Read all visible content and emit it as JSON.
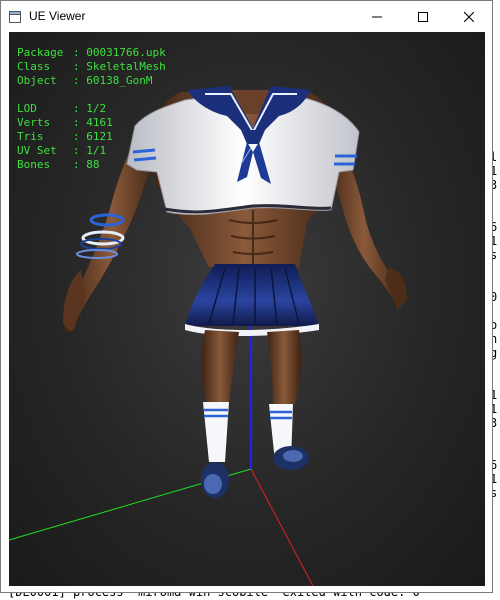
{
  "window": {
    "title": "UE Viewer",
    "app_icon": "window-app-icon"
  },
  "controls": {
    "minimize": "minimize-icon",
    "maximize": "maximize-icon",
    "close": "close-icon"
  },
  "info": {
    "package_label": "Package",
    "package_value": "00031766.upk",
    "class_label": "Class",
    "class_value": "SkeletalMesh",
    "object_label": "Object",
    "object_value": "60138_GonM",
    "lod_label": "LOD",
    "lod_value": "1/2",
    "verts_label": "Verts",
    "verts_value": "4161",
    "tris_label": "Tris",
    "tris_value": "6121",
    "uvset_label": "UV Set",
    "uvset_value": "1/1",
    "bones_label": "Bones",
    "bones_value": "88"
  },
  "console": {
    "side_lines": [
      "l",
      "1",
      "3",
      "",
      "",
      "6",
      "1",
      "s",
      "",
      "",
      "0",
      "",
      "o",
      "n",
      "g",
      "",
      "",
      "1",
      "1",
      "3",
      "",
      "",
      "6",
      "1",
      "s"
    ],
    "bottom_line": "[DE0001] process \"miroma win scobile\" exited with code: 0"
  },
  "colors": {
    "text_green": "#3ee03e",
    "axis_x": "#e02020",
    "axis_y": "#20e020",
    "axis_z": "#2020ff",
    "uniform_navy": "#1b2f7a"
  }
}
